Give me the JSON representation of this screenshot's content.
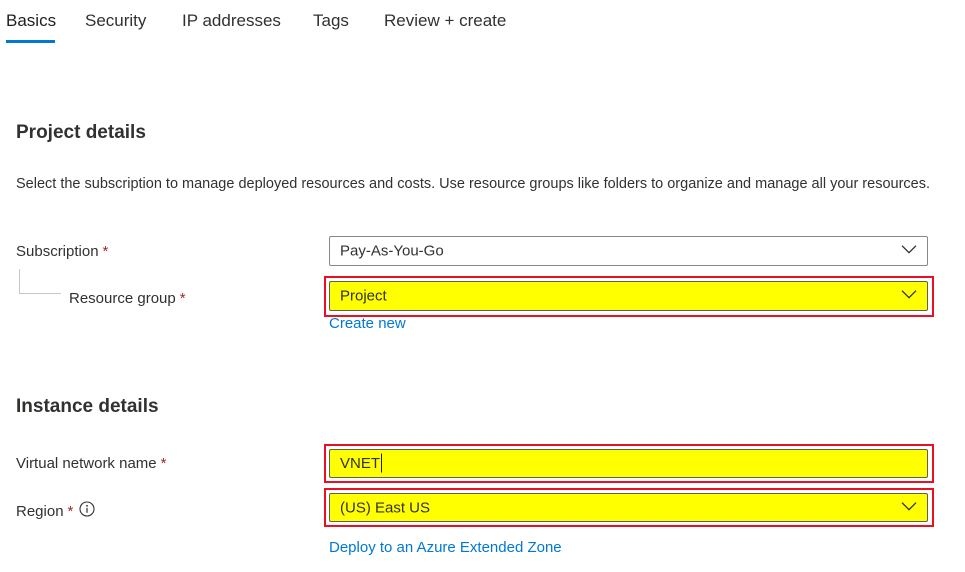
{
  "tabs": [
    {
      "label": "Basics",
      "active": true
    },
    {
      "label": "Security"
    },
    {
      "label": "IP addresses"
    },
    {
      "label": "Tags"
    },
    {
      "label": "Review + create"
    }
  ],
  "project": {
    "title": "Project details",
    "description": "Select the subscription to manage deployed resources and costs. Use resource groups like folders to organize and manage all your resources.",
    "subscription_label": "Subscription",
    "subscription_value": "Pay-As-You-Go",
    "resource_group_label": "Resource group",
    "resource_group_value": "Project",
    "create_new": "Create new"
  },
  "instance": {
    "title": "Instance details",
    "vnet_label": "Virtual network name",
    "vnet_value": "VNET",
    "region_label": "Region",
    "region_value": "(US) East US",
    "extended_zone_link": "Deploy to an Azure Extended Zone"
  },
  "required_marker": "*",
  "colors": {
    "accent": "#0078d4",
    "highlight": "#ffff00",
    "highlight_border": "#e81123",
    "required": "#a4262c"
  },
  "icons": [
    "chevron-down-icon",
    "info-icon"
  ]
}
